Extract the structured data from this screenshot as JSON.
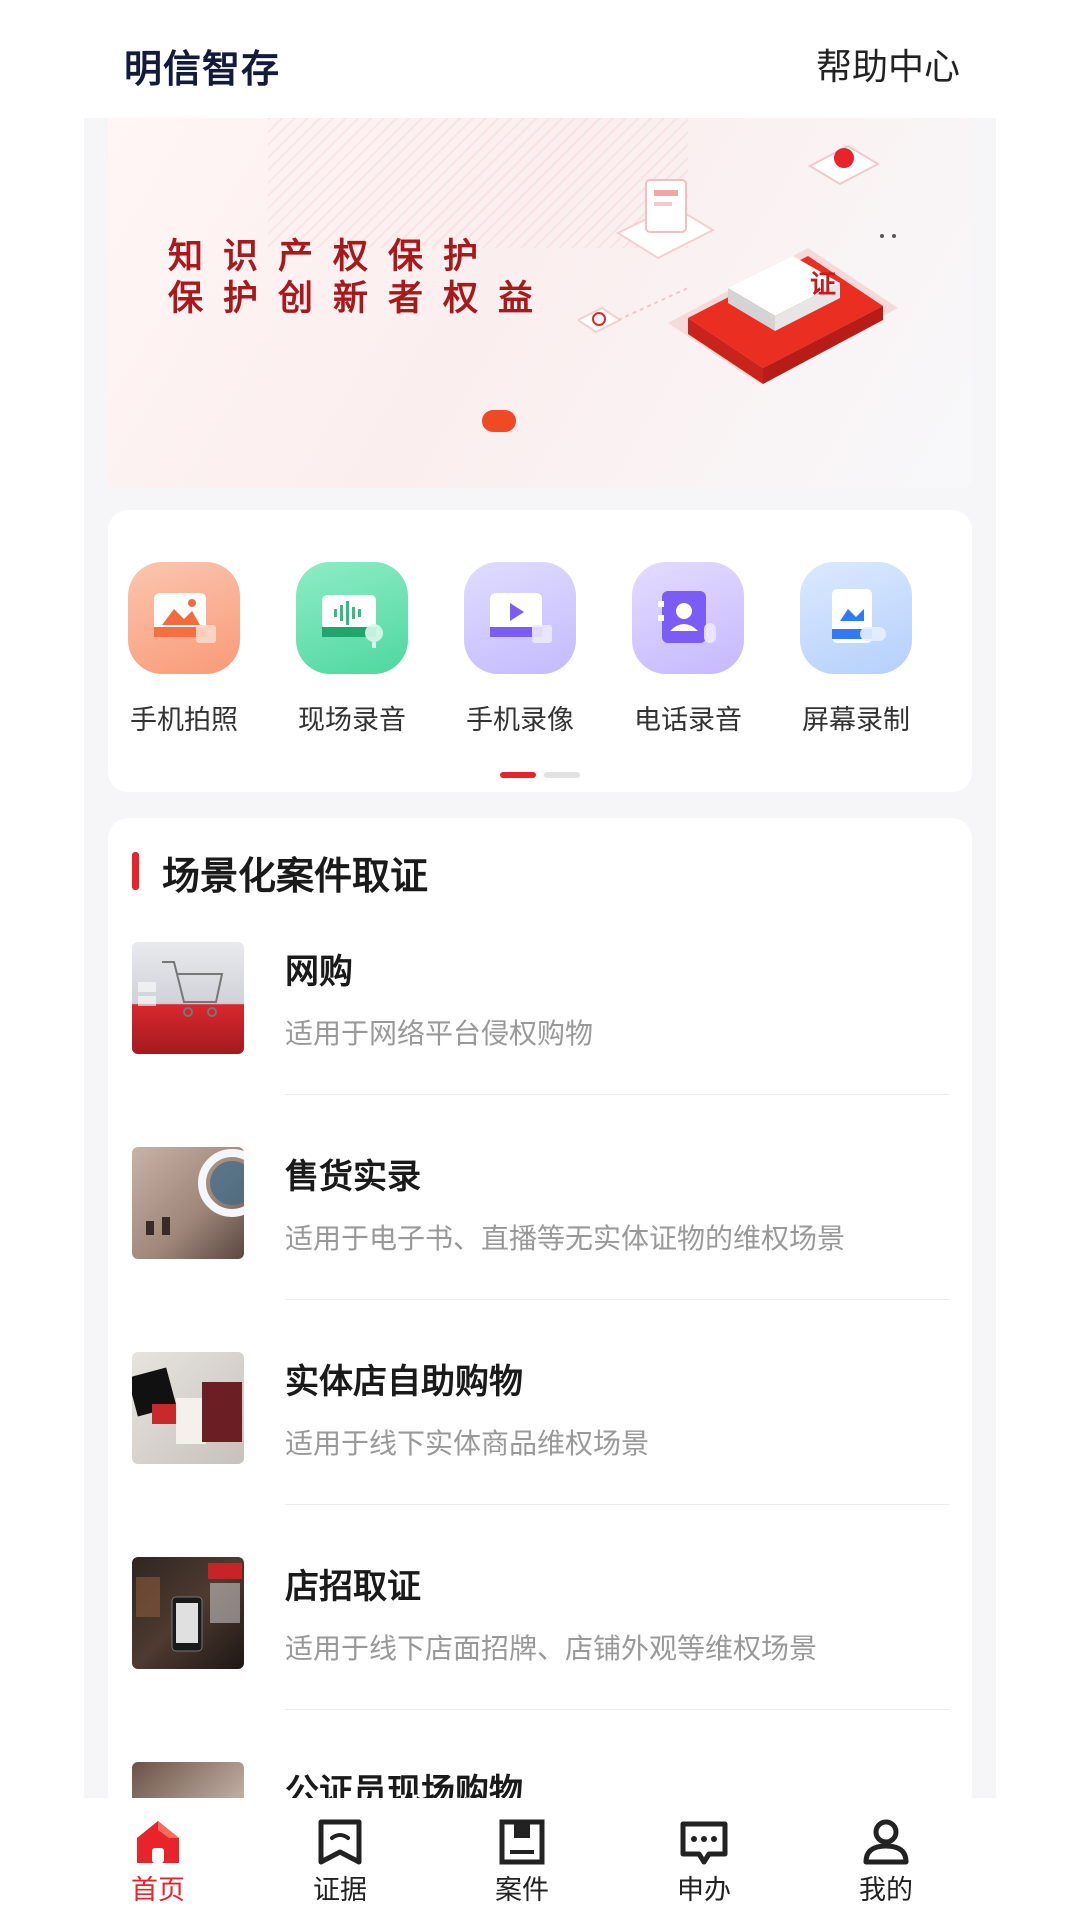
{
  "header": {
    "title": "明信智存",
    "help": "帮助中心"
  },
  "banner": {
    "line1": "知识产权保护",
    "line2": "保护创新者权益",
    "badge": "证",
    "accent_color": "#e8232a"
  },
  "shortcuts": [
    {
      "label": "手机拍照",
      "icon": "photo-icon",
      "color": "#fbb9a2"
    },
    {
      "label": "现场录音",
      "icon": "audio-record-icon",
      "color": "#7fe2bd"
    },
    {
      "label": "手机录像",
      "icon": "video-record-icon",
      "color": "#d3ccff"
    },
    {
      "label": "电话录音",
      "icon": "phone-contact-icon",
      "color": "#d7cdfb"
    },
    {
      "label": "屏幕录制",
      "icon": "screen-record-icon",
      "color": "#c8dcfb"
    }
  ],
  "section": {
    "title": "场景化案件取证"
  },
  "scenes": [
    {
      "name": "网购",
      "desc": "适用于网络平台侵权购物",
      "thumb": "shopping-cart-keyboard"
    },
    {
      "name": "售货实录",
      "desc": "适用于电子书、直播等无实体证物的维权场景",
      "thumb": "livestream-ring-light"
    },
    {
      "name": "实体店自助购物",
      "desc": "适用于线下实体商品维权场景",
      "thumb": "shopping-bags"
    },
    {
      "name": "店招取证",
      "desc": "适用于线下店面招牌、店铺外观等维权场景",
      "thumb": "storefront-phone"
    },
    {
      "name": "公证员现场购物",
      "desc": "",
      "thumb": "notary-purchase"
    }
  ],
  "nav": [
    {
      "label": "首页",
      "icon": "home-icon",
      "active": true
    },
    {
      "label": "证据",
      "icon": "evidence-icon",
      "active": false
    },
    {
      "label": "案件",
      "icon": "case-icon",
      "active": false
    },
    {
      "label": "申办",
      "icon": "apply-icon",
      "active": false
    },
    {
      "label": "我的",
      "icon": "profile-icon",
      "active": false
    }
  ]
}
